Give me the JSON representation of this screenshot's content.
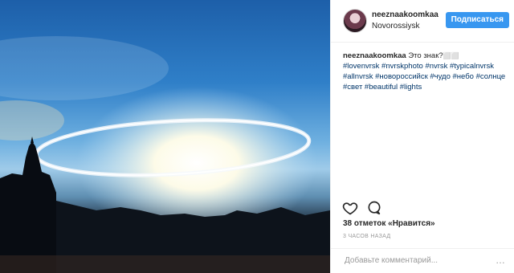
{
  "post": {
    "username": "neeznaakoomkaa",
    "location": "Novorossiysk",
    "follow_label": "Подписаться",
    "caption_user": "neeznaakoomkaa",
    "caption_text": "Это знак?",
    "caption_emoji": "⬜⬜",
    "hashtags": "#lovenvrsk #nvrskphoto #nvrsk #typicalnvrsk #allnvrsk #новороссийск #чудо #небо #солнце #свет #beautiful #lights",
    "likes": "38 отметок «Нравится»",
    "time_ago": "3 ЧАСОВ НАЗАД",
    "comment_placeholder": "Добавьте комментарий...",
    "more_label": "…"
  },
  "icons": {
    "like": "heart-icon",
    "comment": "speech-bubble-icon",
    "more": "ellipsis-icon"
  }
}
